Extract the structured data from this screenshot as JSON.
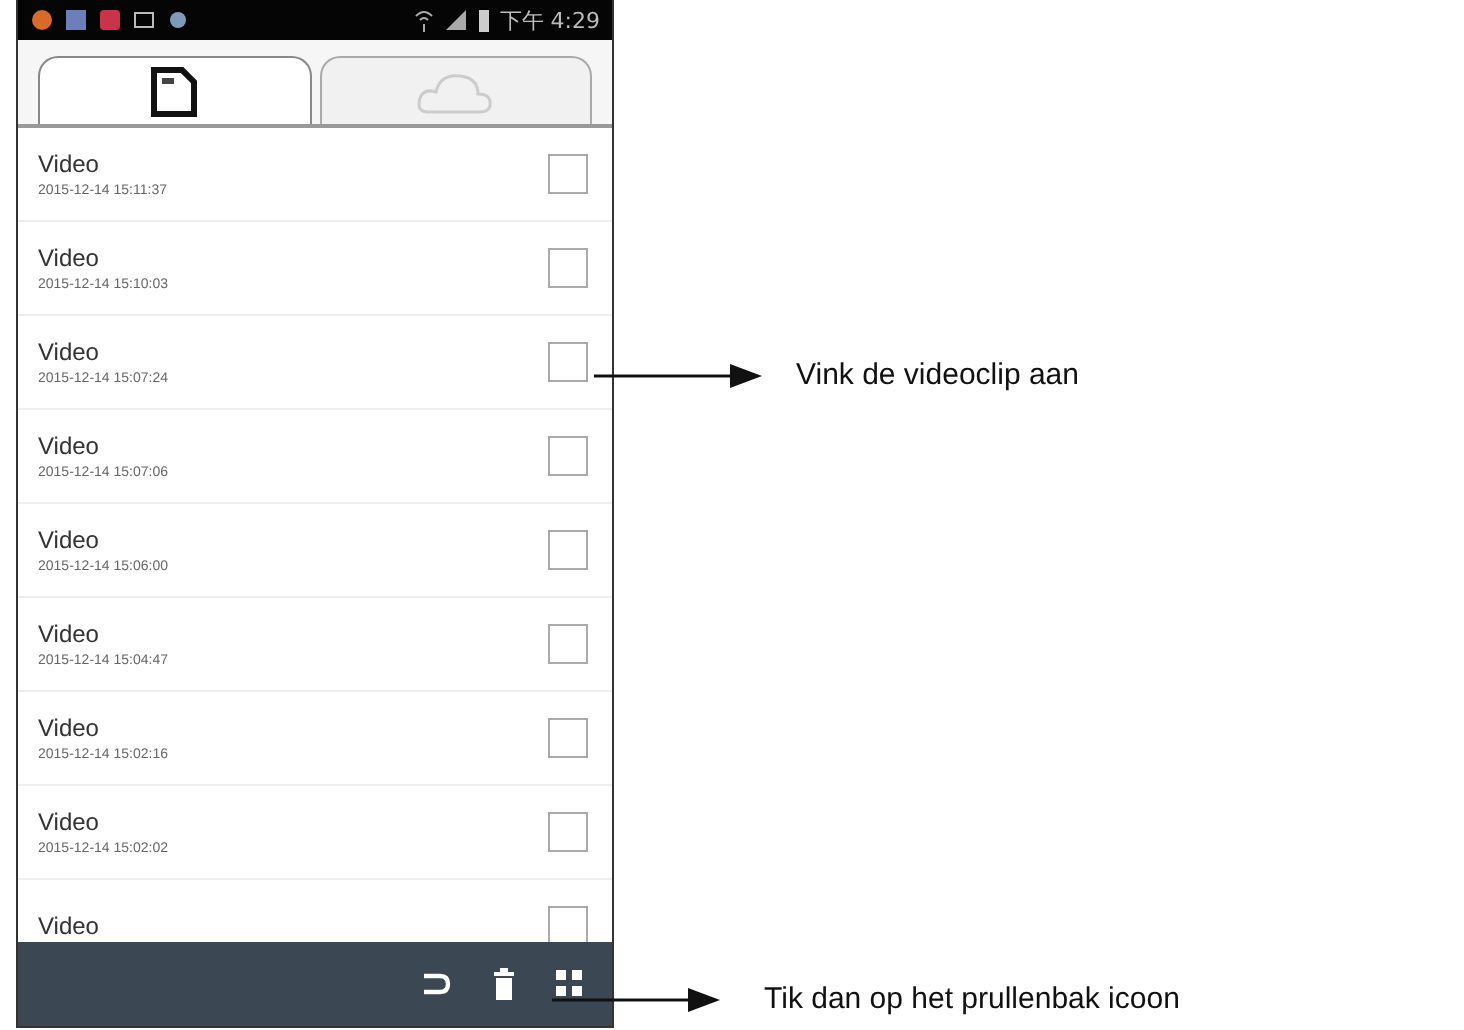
{
  "status_bar": {
    "time": "下午 4:29"
  },
  "tabs": [
    {
      "kind": "card",
      "selected": true
    },
    {
      "kind": "cloud",
      "selected": false
    }
  ],
  "videos": [
    {
      "title": "Video",
      "date": "2015-12-14 15:11:37",
      "checked": false
    },
    {
      "title": "Video",
      "date": "2015-12-14 15:10:03",
      "checked": false
    },
    {
      "title": "Video",
      "date": "2015-12-14 15:07:24",
      "checked": false
    },
    {
      "title": "Video",
      "date": "2015-12-14 15:07:06",
      "checked": false
    },
    {
      "title": "Video",
      "date": "2015-12-14 15:06:00",
      "checked": false
    },
    {
      "title": "Video",
      "date": "2015-12-14 15:04:47",
      "checked": false
    },
    {
      "title": "Video",
      "date": "2015-12-14 15:02:16",
      "checked": false
    },
    {
      "title": "Video",
      "date": "2015-12-14 15:02:02",
      "checked": false
    },
    {
      "title": "Video",
      "checked": false
    }
  ],
  "annotations": [
    {
      "text": "Vink de videoclip aan"
    },
    {
      "text": "Tik dan op het prullenbak icoon"
    }
  ]
}
